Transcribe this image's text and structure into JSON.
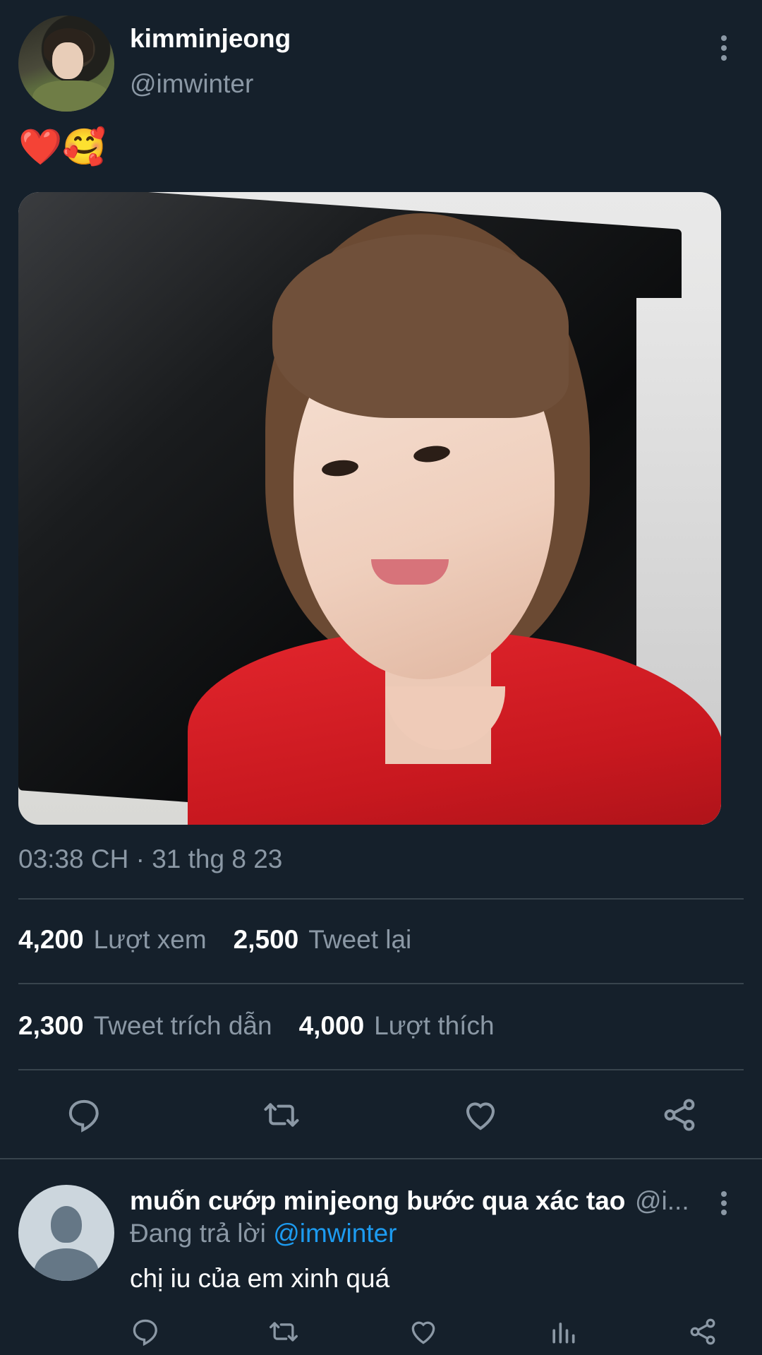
{
  "tweet": {
    "author": {
      "display_name": "kimminjeong",
      "handle": "@imwinter"
    },
    "text": "❤️🥰",
    "timestamp": "03:38 CH · 31 thg 8 23",
    "stats": [
      [
        {
          "num": "4,200",
          "label": "Lượt xem"
        },
        {
          "num": "2,500",
          "label": "Tweet lại"
        }
      ],
      [
        {
          "num": "2,300",
          "label": "Tweet trích dẫn"
        },
        {
          "num": "4,000",
          "label": "Lượt thích"
        }
      ]
    ],
    "actions": [
      "reply-icon",
      "retweet-icon",
      "like-icon",
      "share-icon"
    ]
  },
  "reply": {
    "display_name": "muốn cướp minjeong bước qua xác tao",
    "handle": "@i...",
    "replying_prefix": "Đang trả lời",
    "replying_to": "@imwinter",
    "text": "chị iu của em xinh quá",
    "actions": [
      "reply-icon",
      "retweet-icon",
      "like-icon",
      "views-icon",
      "share-icon"
    ]
  },
  "colors": {
    "background": "#15202b",
    "secondary_text": "#8b98a5",
    "divider": "#38444d",
    "link": "#1d9bf0"
  }
}
